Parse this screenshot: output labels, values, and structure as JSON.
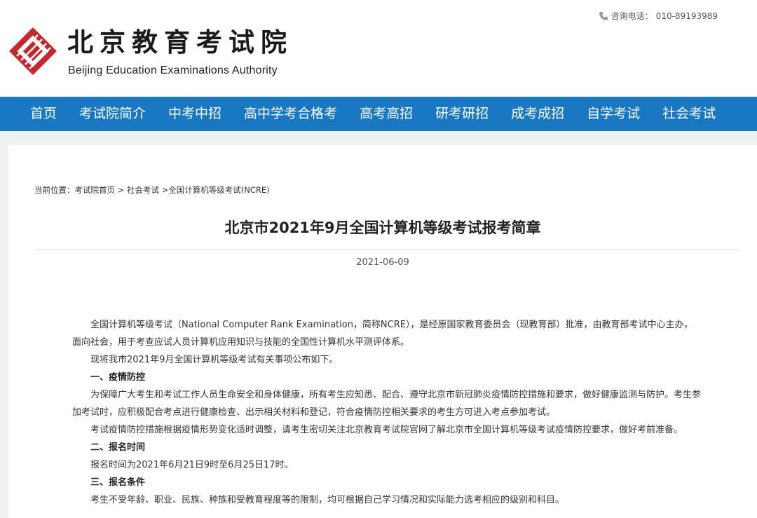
{
  "header": {
    "logo_title": "北京教育考试院",
    "logo_subtitle": "Beijing Education Examinations Authority",
    "hotline_label": "咨询电话：",
    "hotline_number": "010-89193989",
    "brand_color": "#c4272d"
  },
  "nav": {
    "color": "#1a78c2",
    "items": [
      "首页",
      "考试院简介",
      "中考中招",
      "高中学考合格考",
      "高考高招",
      "研考研招",
      "成考成招",
      "自学考试",
      "社会考试"
    ]
  },
  "breadcrumb": {
    "prefix": "当前位置：",
    "home": "考试院首页",
    "sep1": " > ",
    "category": "社会考试",
    "sep2": " >",
    "current": "全国计算机等级考试(NCRE)"
  },
  "article": {
    "title": "北京市2021年9月全国计算机等级考试报考简章",
    "date": "2021-06-09",
    "paragraphs": [
      {
        "type": "text",
        "text": "全国计算机等级考试（National Computer Rank Examination，简称NCRE），是经原国家教育委员会（现教育部）批准，由教育部考试中心主办，面向社会，用于考查应试人员计算机应用知识与技能的全国性计算机水平测评体系。"
      },
      {
        "type": "text",
        "text": "现将我市2021年9月全国计算机等级考试有关事项公布如下。"
      },
      {
        "type": "heading",
        "text": "一、疫情防控"
      },
      {
        "type": "text",
        "text": "为保障广大考生和考试工作人员生命安全和身体健康，所有考生应知悉、配合、遵守北京市新冠肺炎疫情防控措施和要求，做好健康监测与防护。考生参加考试时，应积极配合考点进行健康检查、出示相关材料和登记，符合疫情防控相关要求的考生方可进入考点参加考试。"
      },
      {
        "type": "text",
        "text": "考试疫情防控措施根据疫情形势变化适时调整，请考生密切关注北京教育考试院官网了解北京市全国计算机等级考试疫情防控要求，做好考前准备。"
      },
      {
        "type": "heading",
        "text": "二、报名时间"
      },
      {
        "type": "text",
        "text": "报名时间为2021年6月21日9时至6月25日17时。"
      },
      {
        "type": "heading",
        "text": "三、报名条件"
      },
      {
        "type": "text",
        "text": "考生不受年龄、职业、民族、种族和受教育程度等的限制，均可根据自己学习情况和实际能力选考相应的级别和科目。"
      }
    ]
  }
}
